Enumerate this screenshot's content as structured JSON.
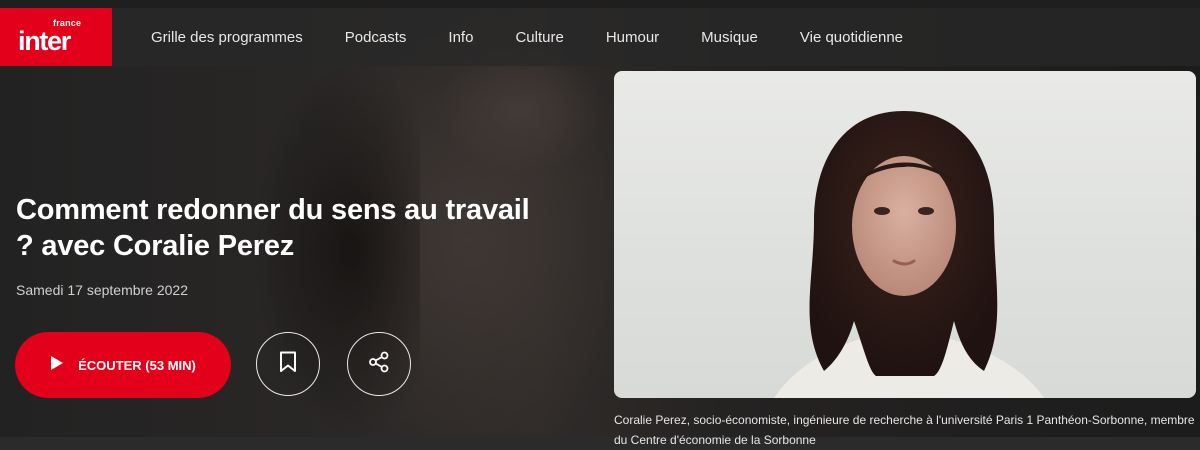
{
  "logo": {
    "brand_small": "france",
    "brand_main": "inter",
    "color": "#e2001a"
  },
  "nav": {
    "items": [
      {
        "label": "Grille des programmes"
      },
      {
        "label": "Podcasts"
      },
      {
        "label": "Info"
      },
      {
        "label": "Culture"
      },
      {
        "label": "Humour"
      },
      {
        "label": "Musique"
      },
      {
        "label": "Vie quotidienne"
      }
    ]
  },
  "episode": {
    "title": "Comment redonner du sens au travail ? avec Coralie Perez",
    "date": "Samedi 17 septembre 2022",
    "listen_label": "ÉCOUTER (53 MIN)",
    "play_icon": "play-icon",
    "bookmark_icon": "bookmark-icon",
    "share_icon": "share-icon"
  },
  "photo": {
    "caption": "Coralie Perez, socio-économiste, ingénieure de recherche à l'université Paris 1 Panthéon-Sorbonne, membre du Centre d'économie de la Sorbonne"
  },
  "colors": {
    "accent": "#e2001a",
    "nav_bg": "#282828",
    "text": "#ffffff"
  }
}
